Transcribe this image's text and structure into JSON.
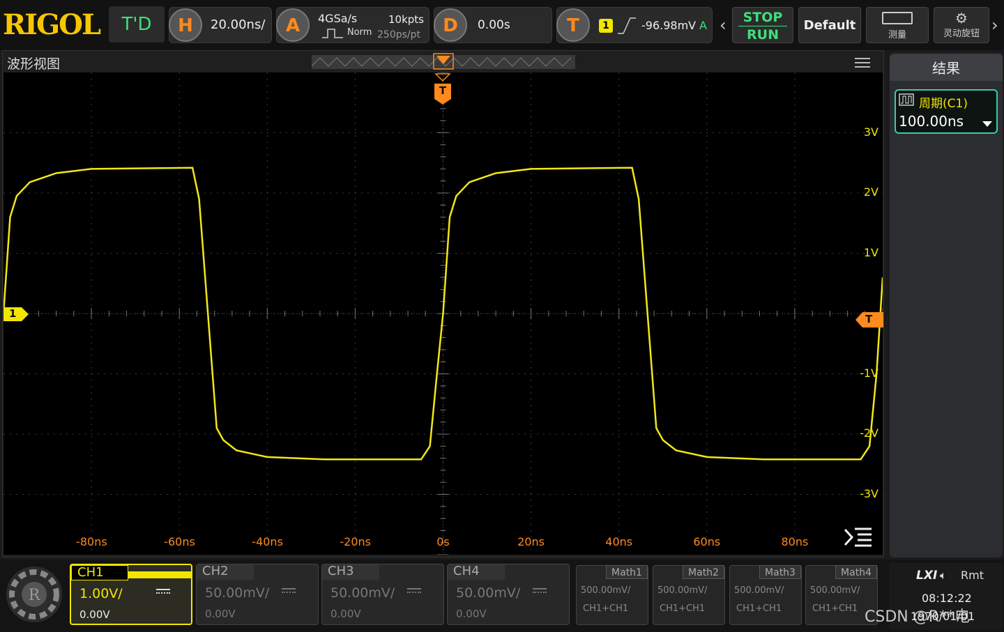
{
  "top": {
    "logo": "RIGOL",
    "mode_badge": "T'D",
    "horizontal": {
      "key": "H",
      "value": "20.00ns/"
    },
    "acquire": {
      "key": "A",
      "rate": "4GSa/s",
      "depth": "10kpts",
      "mode": "Norm",
      "resolution": "250ps/pt"
    },
    "delay": {
      "key": "D",
      "value": "0.00s"
    },
    "trigger": {
      "key": "T",
      "source": "1",
      "level": "-96.98mV",
      "sweep": "A"
    },
    "run_state": {
      "stop": "STOP",
      "run": "RUN"
    },
    "default_label": "Default",
    "measure_label": "测量",
    "knob_label": "灵动旋钮"
  },
  "waveform": {
    "title": "波形视图",
    "trigger_marker": "T",
    "channel_marker": "1",
    "y_ticks": [
      "3V",
      "2V",
      "1V",
      "-1V",
      "-2V",
      "-3V"
    ],
    "x_ticks": [
      "-80ns",
      "-60ns",
      "-40ns",
      "-20ns",
      "0s",
      "20ns",
      "40ns",
      "60ns",
      "80ns"
    ],
    "trace_color": "#f0e818"
  },
  "results": {
    "title": "结果",
    "measurement": {
      "label": "周期(C1)",
      "value": "100.00ns"
    }
  },
  "channels": [
    {
      "name": "CH1",
      "scale": "1.00V/",
      "offset": "0.00V",
      "color": "#f2e600",
      "active": true
    },
    {
      "name": "CH2",
      "scale": "50.00mV/",
      "offset": "0.00V",
      "active": false
    },
    {
      "name": "CH3",
      "scale": "50.00mV/",
      "offset": "0.00V",
      "active": false
    },
    {
      "name": "CH4",
      "scale": "50.00mV/",
      "offset": "0.00V",
      "active": false
    }
  ],
  "maths": [
    {
      "name": "Math1",
      "scale": "500.00mV/",
      "source": "CH1+CH1"
    },
    {
      "name": "Math2",
      "scale": "500.00mV/",
      "source": "CH1+CH1"
    },
    {
      "name": "Math3",
      "scale": "500.00mV/",
      "source": "CH1+CH1"
    },
    {
      "name": "Math4",
      "scale": "500.00mV/",
      "source": "CH1+CH1"
    }
  ],
  "status": {
    "lxi": "LXI",
    "rmt": "Rmt",
    "time": "08:12:22",
    "date": "1970/01/01",
    "watermark": "CSDN @R**电"
  }
}
